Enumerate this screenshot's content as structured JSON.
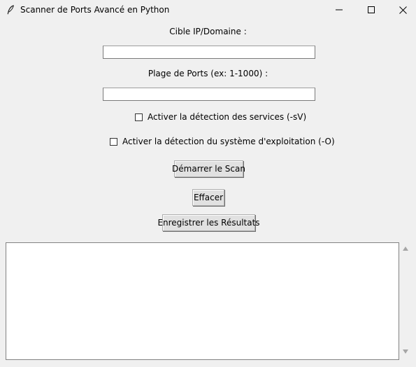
{
  "window": {
    "title": "Scanner de Ports Avancé en Python",
    "icon": "feather-icon",
    "controls": [
      "minimize-icon",
      "maximize-icon",
      "close-icon"
    ]
  },
  "form": {
    "target_label": "Cible IP/Domaine :",
    "target_value": "",
    "port_range_label": "Plage de Ports (ex: 1-1000) :",
    "port_range_value": "",
    "service_detection_label": "Activer la détection des services (-sV)",
    "service_detection_checked": false,
    "os_detection_label": "Activer la détection du système d'exploitation (-O)",
    "os_detection_checked": false
  },
  "buttons": {
    "start_scan": "Démarrer le Scan",
    "clear": "Effacer",
    "save_results": "Enregistrer les Résultats"
  },
  "output": {
    "text": ""
  }
}
